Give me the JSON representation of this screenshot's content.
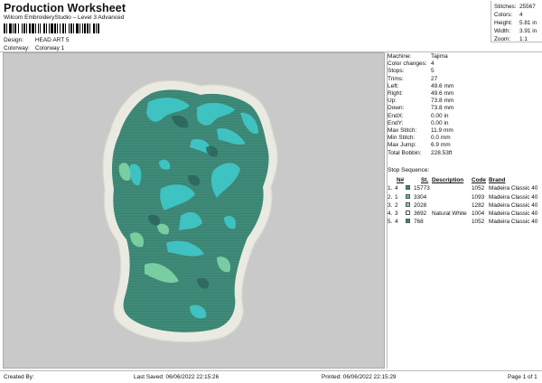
{
  "header": {
    "title": "Production Worksheet",
    "subtitle": "Wilcom EmbroideryStudio – Level 3 Advanced",
    "design_label": "Design:",
    "design_value": "HEAD ART 5",
    "colorway_label": "Colorway:",
    "colorway_value": "Colorway 1"
  },
  "stats": [
    {
      "label": "Stitches:",
      "value": "25567"
    },
    {
      "label": "Colors:",
      "value": "4"
    },
    {
      "label": "Height:",
      "value": "5.81 in"
    },
    {
      "label": "Width:",
      "value": "3.91 in"
    },
    {
      "label": "Zoom:",
      "value": "1:1"
    }
  ],
  "machine_info": [
    {
      "label": "Machine:",
      "value": "Tajima"
    },
    {
      "label": "Color changes:",
      "value": "4"
    },
    {
      "label": "Stops:",
      "value": "5"
    },
    {
      "label": "Trims:",
      "value": "27"
    },
    {
      "label": "Left:",
      "value": "49.6 mm"
    },
    {
      "label": "Right:",
      "value": "49.6 mm"
    },
    {
      "label": "Up:",
      "value": "73.8 mm"
    },
    {
      "label": "Down:",
      "value": "73.8 mm"
    },
    {
      "label": "EndX:",
      "value": "0.00 in"
    },
    {
      "label": "EndY:",
      "value": "0.00 in"
    },
    {
      "label": "Max Stitch:",
      "value": "11.9 mm"
    },
    {
      "label": "Min Stitch:",
      "value": "0.0 mm"
    },
    {
      "label": "Max Jump:",
      "value": "6.9 mm"
    },
    {
      "label": "Total Bobbin:",
      "value": "228.53ft"
    }
  ],
  "stop_sequence": {
    "label": "Stop Sequence:",
    "columns": [
      "N#",
      "St.",
      "Description",
      "Code",
      "Brand"
    ],
    "rows": [
      {
        "stop": "1.",
        "n": "4",
        "color": "#3e8c7c",
        "st": "15773",
        "desc": "",
        "code": "1052",
        "brand": "Madeira Classic 40"
      },
      {
        "stop": "2.",
        "n": "1",
        "color": "#3ec4c8",
        "st": "3304",
        "desc": "",
        "code": "1093",
        "brand": "Madeira Classic 40"
      },
      {
        "stop": "3.",
        "n": "2",
        "color": "#7ed3a8",
        "st": "2028",
        "desc": "",
        "code": "1282",
        "brand": "Madeira Classic 40"
      },
      {
        "stop": "4.",
        "n": "3",
        "color": "#f4f4ee",
        "st": "3692",
        "desc": "Natural White",
        "code": "1004",
        "brand": "Madeira Classic 40"
      },
      {
        "stop": "5.",
        "n": "4",
        "color": "#3e8c7c",
        "st": "768",
        "desc": "",
        "code": "1052",
        "brand": "Madeira Classic 40"
      }
    ]
  },
  "footer": {
    "created_by": "Created By:",
    "last_saved": "Last Saved: 06/06/2022 22:15:26",
    "printed": "Printed: 06/06/2022 22:15:29",
    "page": "Page 1 of 1"
  }
}
